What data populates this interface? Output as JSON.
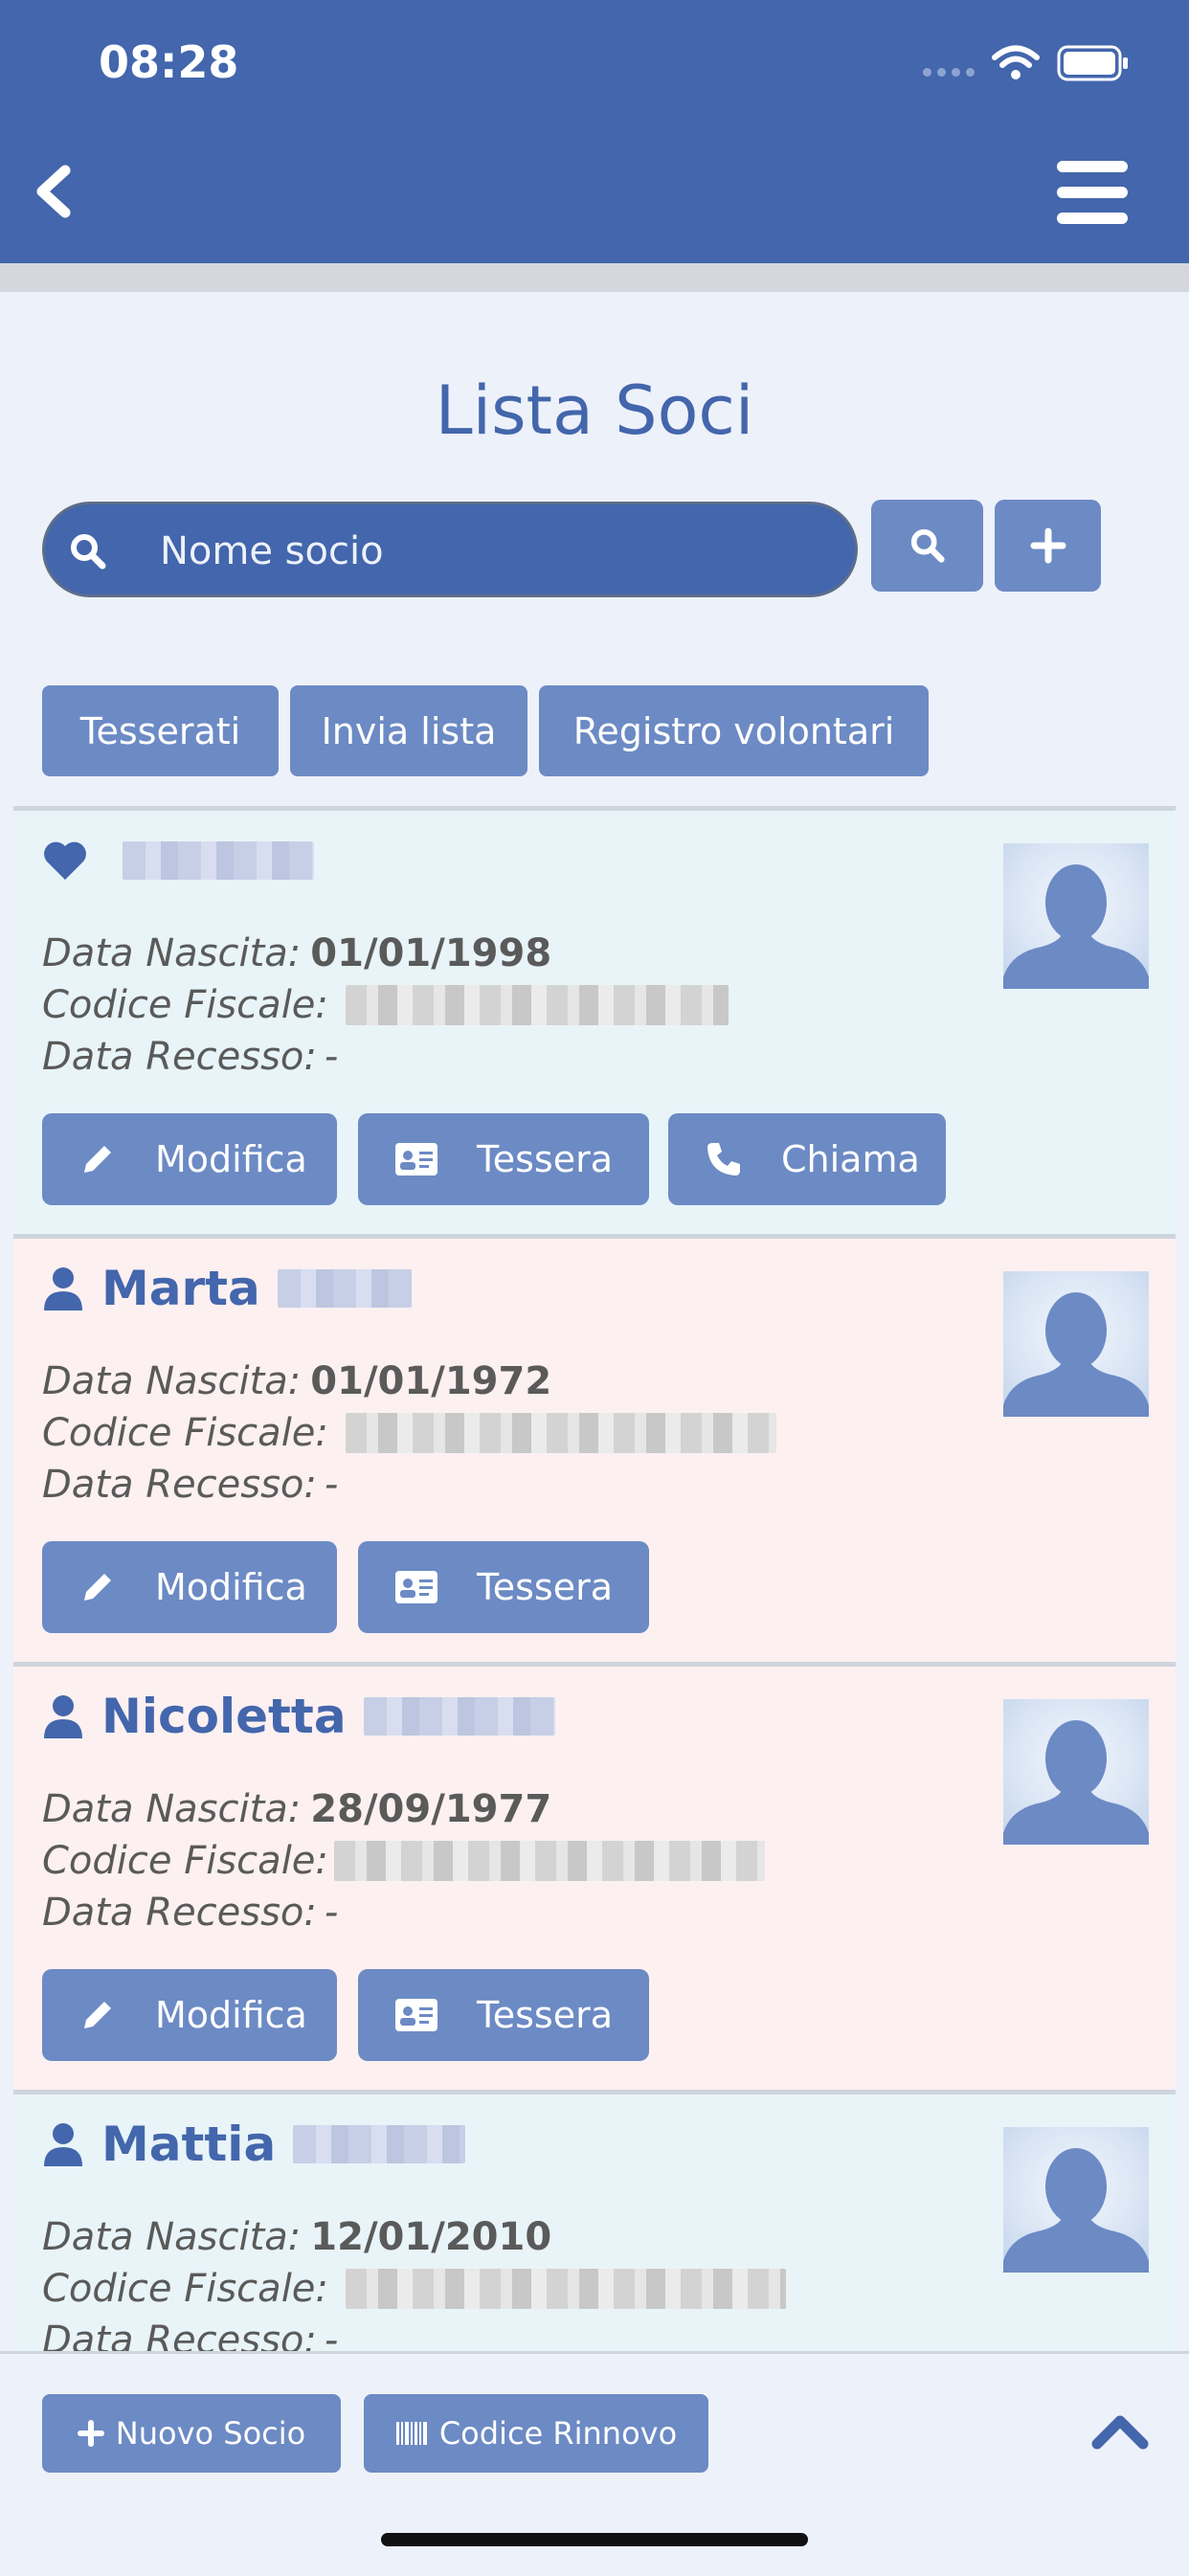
{
  "status_bar": {
    "time": "08:28"
  },
  "nav": {
    "back_icon": "chevron-left-icon",
    "menu_icon": "hamburger-icon"
  },
  "page": {
    "title": "Lista Soci"
  },
  "search": {
    "placeholder": "Nome socio",
    "search_icon": "search-icon",
    "add_icon": "plus-icon"
  },
  "filters": [
    {
      "label": "Tesserati"
    },
    {
      "label": "Invia lista"
    },
    {
      "label": "Registro volontari"
    }
  ],
  "field_labels": {
    "birth": "Data Nascita:",
    "tax_code": "Codice Fiscale:",
    "withdrawal": "Data Recesso:"
  },
  "action_labels": {
    "edit": "Modifica",
    "card": "Tessera",
    "call": "Chiama"
  },
  "members": [
    {
      "first_name": "",
      "icon": "heart-icon",
      "birth": "01/01/1998",
      "withdrawal": "-",
      "tint": "#e8f4f8",
      "can_call": true
    },
    {
      "first_name": "Marta",
      "icon": "user-icon",
      "birth": "01/01/1972",
      "withdrawal": "-",
      "tint": "#fdf0f1",
      "can_call": false
    },
    {
      "first_name": "Nicoletta",
      "icon": "user-icon",
      "birth": "28/09/1977",
      "withdrawal": "-",
      "tint": "#fdf0f1",
      "can_call": false
    },
    {
      "first_name": "Mattia",
      "icon": "user-icon",
      "birth": "12/01/2010",
      "withdrawal": "-",
      "tint": "#e8f4f8",
      "can_call": false
    }
  ],
  "bottom": {
    "new_member": "Nuovo Socio",
    "renewal_code": "Codice Rinnovo",
    "scroll_top_icon": "chevron-up-icon"
  },
  "colors": {
    "primary": "#4366ac",
    "button": "#6c8ac4",
    "background": "#edf1f9"
  }
}
